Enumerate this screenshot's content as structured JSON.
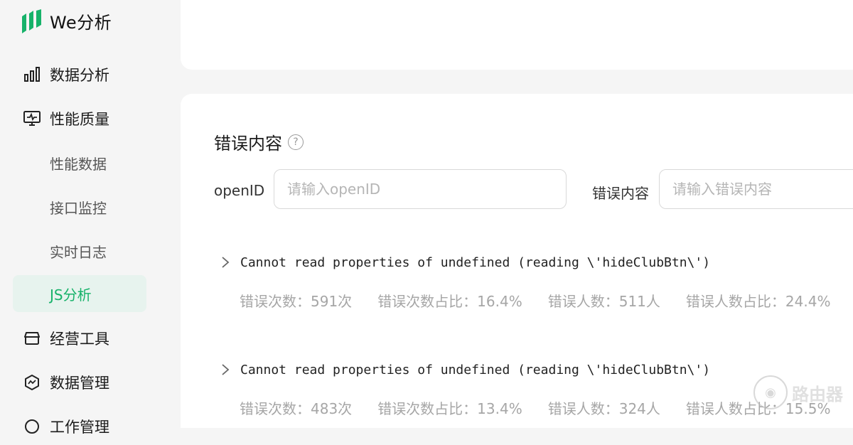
{
  "app": {
    "name": "We分析",
    "brand_color": "#17b26a"
  },
  "sidebar": {
    "items": [
      {
        "label": "数据分析",
        "icon": "bar-chart-icon"
      },
      {
        "label": "性能质量",
        "icon": "monitor-icon"
      },
      {
        "label": "性能数据"
      },
      {
        "label": "接口监控"
      },
      {
        "label": "实时日志"
      },
      {
        "label": "JS分析",
        "active": true
      },
      {
        "label": "经营工具",
        "icon": "shop-icon"
      },
      {
        "label": "数据管理",
        "icon": "data-manage-icon"
      },
      {
        "label": "工作管理",
        "icon": "settings-icon"
      }
    ]
  },
  "main": {
    "section_title": "错误内容",
    "filters": {
      "openid_label": "openID",
      "openid_placeholder": "请输入openID",
      "error_label": "错误内容",
      "error_placeholder": "请输入错误内容"
    },
    "errors": [
      {
        "message": "Cannot read properties of undefined (reading \\'hideClubBtn\\')",
        "count": "错误次数：591次",
        "count_ratio": "错误次数占比：16.4%",
        "users": "错误人数：511人",
        "users_ratio": "错误人数占比：24.4%"
      },
      {
        "message": "Cannot read properties of undefined (reading \\'hideClubBtn\\')",
        "count": "错误次数：483次",
        "count_ratio": "错误次数占比：13.4%",
        "users": "错误人数：324人",
        "users_ratio": "错误人数占比：15.5%"
      }
    ]
  },
  "watermark": {
    "text": "路由器"
  }
}
